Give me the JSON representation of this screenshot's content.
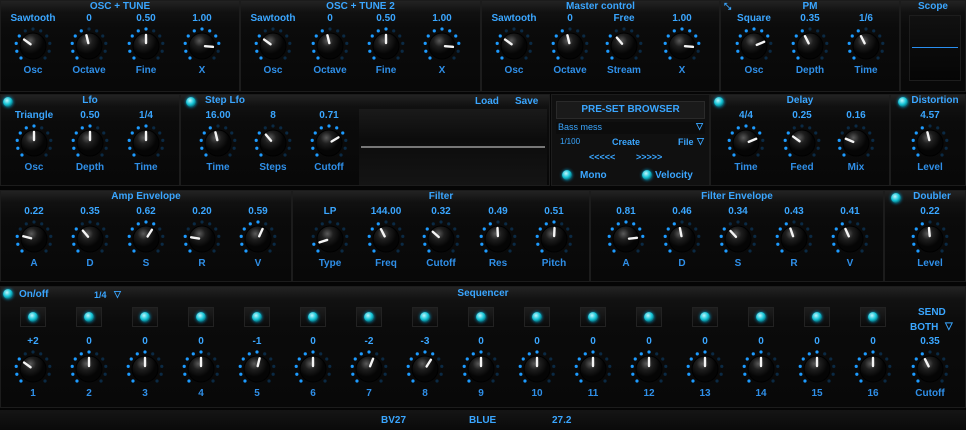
{
  "colors": {
    "accent": "#3aa6ff",
    "led": "#13c3d6",
    "background": "#050505"
  },
  "osc_tune": {
    "title": "OSC + TUNE",
    "values": [
      "Sawtooth",
      "0",
      "0.50",
      "1.00"
    ],
    "labels": [
      "Osc",
      "Octave",
      "Fine",
      "X"
    ],
    "levels": [
      0.3,
      0.45,
      0.5,
      0.85
    ]
  },
  "osc_tune2": {
    "title": "OSC + TUNE 2",
    "values": [
      "Sawtooth",
      "0",
      "0.50",
      "1.00"
    ],
    "labels": [
      "Osc",
      "Octave",
      "Fine",
      "X"
    ],
    "levels": [
      0.3,
      0.45,
      0.5,
      0.85
    ]
  },
  "master": {
    "title": "Master control",
    "values": [
      "Sawtooth",
      "0",
      "Free",
      "1.00"
    ],
    "labels": [
      "Osc",
      "Octave",
      "Stream",
      "X"
    ],
    "levels": [
      0.3,
      0.45,
      0.35,
      0.85
    ]
  },
  "pm": {
    "title": "PM",
    "values": [
      "Square",
      "0.35",
      "1/6"
    ],
    "labels": [
      "Osc",
      "Depth",
      "Time"
    ],
    "levels": [
      0.75,
      0.4,
      0.4
    ]
  },
  "scope": {
    "title": "Scope"
  },
  "lfo": {
    "title": "Lfo",
    "values": [
      "Triangle",
      "0.50",
      "1/4"
    ],
    "labels": [
      "Osc",
      "Depth",
      "Time"
    ],
    "levels": [
      0.5,
      0.5,
      0.5
    ]
  },
  "step_lfo": {
    "title": "Step Lfo",
    "values": [
      "16.00",
      "8",
      "0.71"
    ],
    "labels": [
      "Time",
      "Steps",
      "Cutoff"
    ],
    "levels": [
      0.45,
      0.35,
      0.72
    ],
    "load": "Load",
    "save": "Save"
  },
  "preset": {
    "title": "PRE-SET BROWSER",
    "name": "Bass mess",
    "counter": "1/100",
    "create": "Create",
    "file": "File",
    "prev": "<<<<<",
    "next": ">>>>>",
    "mono": "Mono",
    "velocity": "Velocity"
  },
  "delay": {
    "title": "Delay",
    "values": [
      "4/4",
      "0.25",
      "0.16"
    ],
    "labels": [
      "Time",
      "Feed",
      "Mix"
    ],
    "levels": [
      0.75,
      0.3,
      0.25
    ]
  },
  "distortion": {
    "title": "Distortion",
    "value": "4.57",
    "label": "Level",
    "level": 0.45
  },
  "amp_env": {
    "title": "Amp Envelope",
    "values": [
      "0.22",
      "0.35",
      "0.62",
      "0.20",
      "0.59"
    ],
    "labels": [
      "A",
      "D",
      "S",
      "R",
      "V"
    ],
    "levels": [
      0.22,
      0.35,
      0.62,
      0.2,
      0.59
    ]
  },
  "filter": {
    "title": "Filter",
    "values": [
      "LP",
      "144.00",
      "0.32",
      "0.49",
      "0.51"
    ],
    "labels": [
      "Type",
      "Freq",
      "Cutoff",
      "Res",
      "Pitch"
    ],
    "levels": [
      0.1,
      0.4,
      0.32,
      0.49,
      0.51
    ]
  },
  "filter_env": {
    "title": "Filter Envelope",
    "values": [
      "0.81",
      "0.46",
      "0.34",
      "0.43",
      "0.41"
    ],
    "labels": [
      "A",
      "D",
      "S",
      "R",
      "V"
    ],
    "levels": [
      0.81,
      0.46,
      0.34,
      0.43,
      0.41
    ]
  },
  "doubler": {
    "title": "Doubler",
    "value": "0.22",
    "label": "Level",
    "level": 0.48
  },
  "sequencer": {
    "title": "Sequencer",
    "onoff": "On/off",
    "rate": "1/4",
    "steps": [
      {
        "value": "+2",
        "label": "1",
        "level": 0.3
      },
      {
        "value": "0",
        "label": "2",
        "level": 0.5
      },
      {
        "value": "0",
        "label": "3",
        "level": 0.5
      },
      {
        "value": "0",
        "label": "4",
        "level": 0.5
      },
      {
        "value": "-1",
        "label": "5",
        "level": 0.55
      },
      {
        "value": "0",
        "label": "6",
        "level": 0.5
      },
      {
        "value": "-2",
        "label": "7",
        "level": 0.58
      },
      {
        "value": "-3",
        "label": "8",
        "level": 0.62
      },
      {
        "value": "0",
        "label": "9",
        "level": 0.5
      },
      {
        "value": "0",
        "label": "10",
        "level": 0.5
      },
      {
        "value": "0",
        "label": "11",
        "level": 0.5
      },
      {
        "value": "0",
        "label": "12",
        "level": 0.5
      },
      {
        "value": "0",
        "label": "13",
        "level": 0.5
      },
      {
        "value": "0",
        "label": "14",
        "level": 0.5
      },
      {
        "value": "0",
        "label": "15",
        "level": 0.5
      },
      {
        "value": "0",
        "label": "16",
        "level": 0.5
      }
    ],
    "send": "SEND",
    "send_mode": "BOTH",
    "cutoff_value": "0.35",
    "cutoff_label": "Cutoff",
    "cutoff_level": 0.4
  },
  "footer": {
    "left": "BV27",
    "mid": "BLUE",
    "right": "27.2"
  }
}
